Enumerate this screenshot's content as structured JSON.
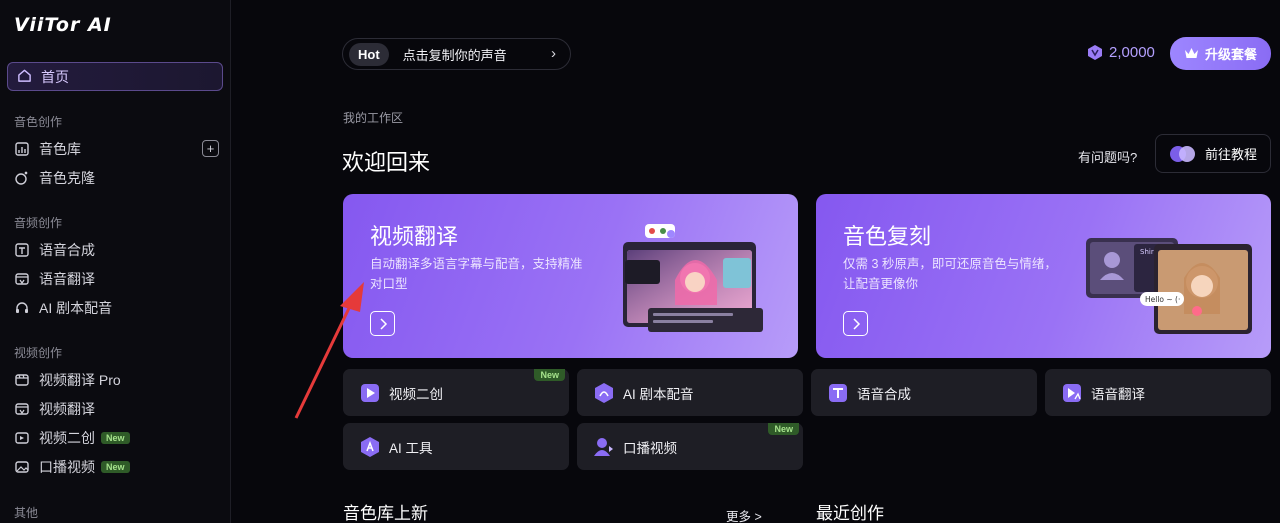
{
  "app": {
    "logo_text": "ViiTor AI"
  },
  "sidebar": {
    "home_label": "首页",
    "sections": [
      {
        "title": "音色创作",
        "items": [
          {
            "label": "音色库"
          },
          {
            "label": "音色克隆"
          }
        ]
      },
      {
        "title": "音频创作",
        "items": [
          {
            "label": "语音合成"
          },
          {
            "label": "语音翻译"
          },
          {
            "label": "AI 剧本配音"
          }
        ]
      },
      {
        "title": "视频创作",
        "items": [
          {
            "label": "视频翻译 Pro"
          },
          {
            "label": "视频翻译"
          },
          {
            "label": "视频二创",
            "badge": "New"
          },
          {
            "label": "口播视频",
            "badge": "New"
          }
        ]
      },
      {
        "title": "其他",
        "items": []
      }
    ],
    "add_symbol": "+"
  },
  "header": {
    "hot_tag": "Hot",
    "hot_text": "点击复制你的声音",
    "hot_arrow": "›",
    "credits": "2,0000",
    "upgrade_label": "升级套餐"
  },
  "workspace": {
    "label": "我的工作区",
    "welcome": "欢迎回来",
    "question": "有问题吗?",
    "tutorial_label": "前往教程"
  },
  "feature_cards": [
    {
      "title": "视频翻译",
      "desc": "自动翻译多语言字幕与配音，支持精准对口型"
    },
    {
      "title": "音色复刻",
      "desc": "仅需 3 秒原声，即可还原音色与情绪，让配音更像你"
    }
  ],
  "card_art": {
    "hello_bubble": "Hello ~ (·",
    "shirt_label": "Shirt"
  },
  "tools": [
    {
      "label": "视频二创",
      "badge": "New"
    },
    {
      "label": "AI 剧本配音",
      "badge": ""
    },
    {
      "label": "语音合成",
      "badge": ""
    },
    {
      "label": "语音翻译",
      "badge": ""
    },
    {
      "label": "AI 工具",
      "badge": ""
    },
    {
      "label": "口播视频",
      "badge": "New"
    }
  ],
  "bottom": {
    "voice_lib_title": "音色库上新",
    "more_label": "更多 >",
    "recent_title": "最近创作"
  },
  "colors": {
    "accent": "#8f73f7",
    "background": "#07070c",
    "card": "#1e1e25",
    "new_badge": "#2f5b28"
  }
}
